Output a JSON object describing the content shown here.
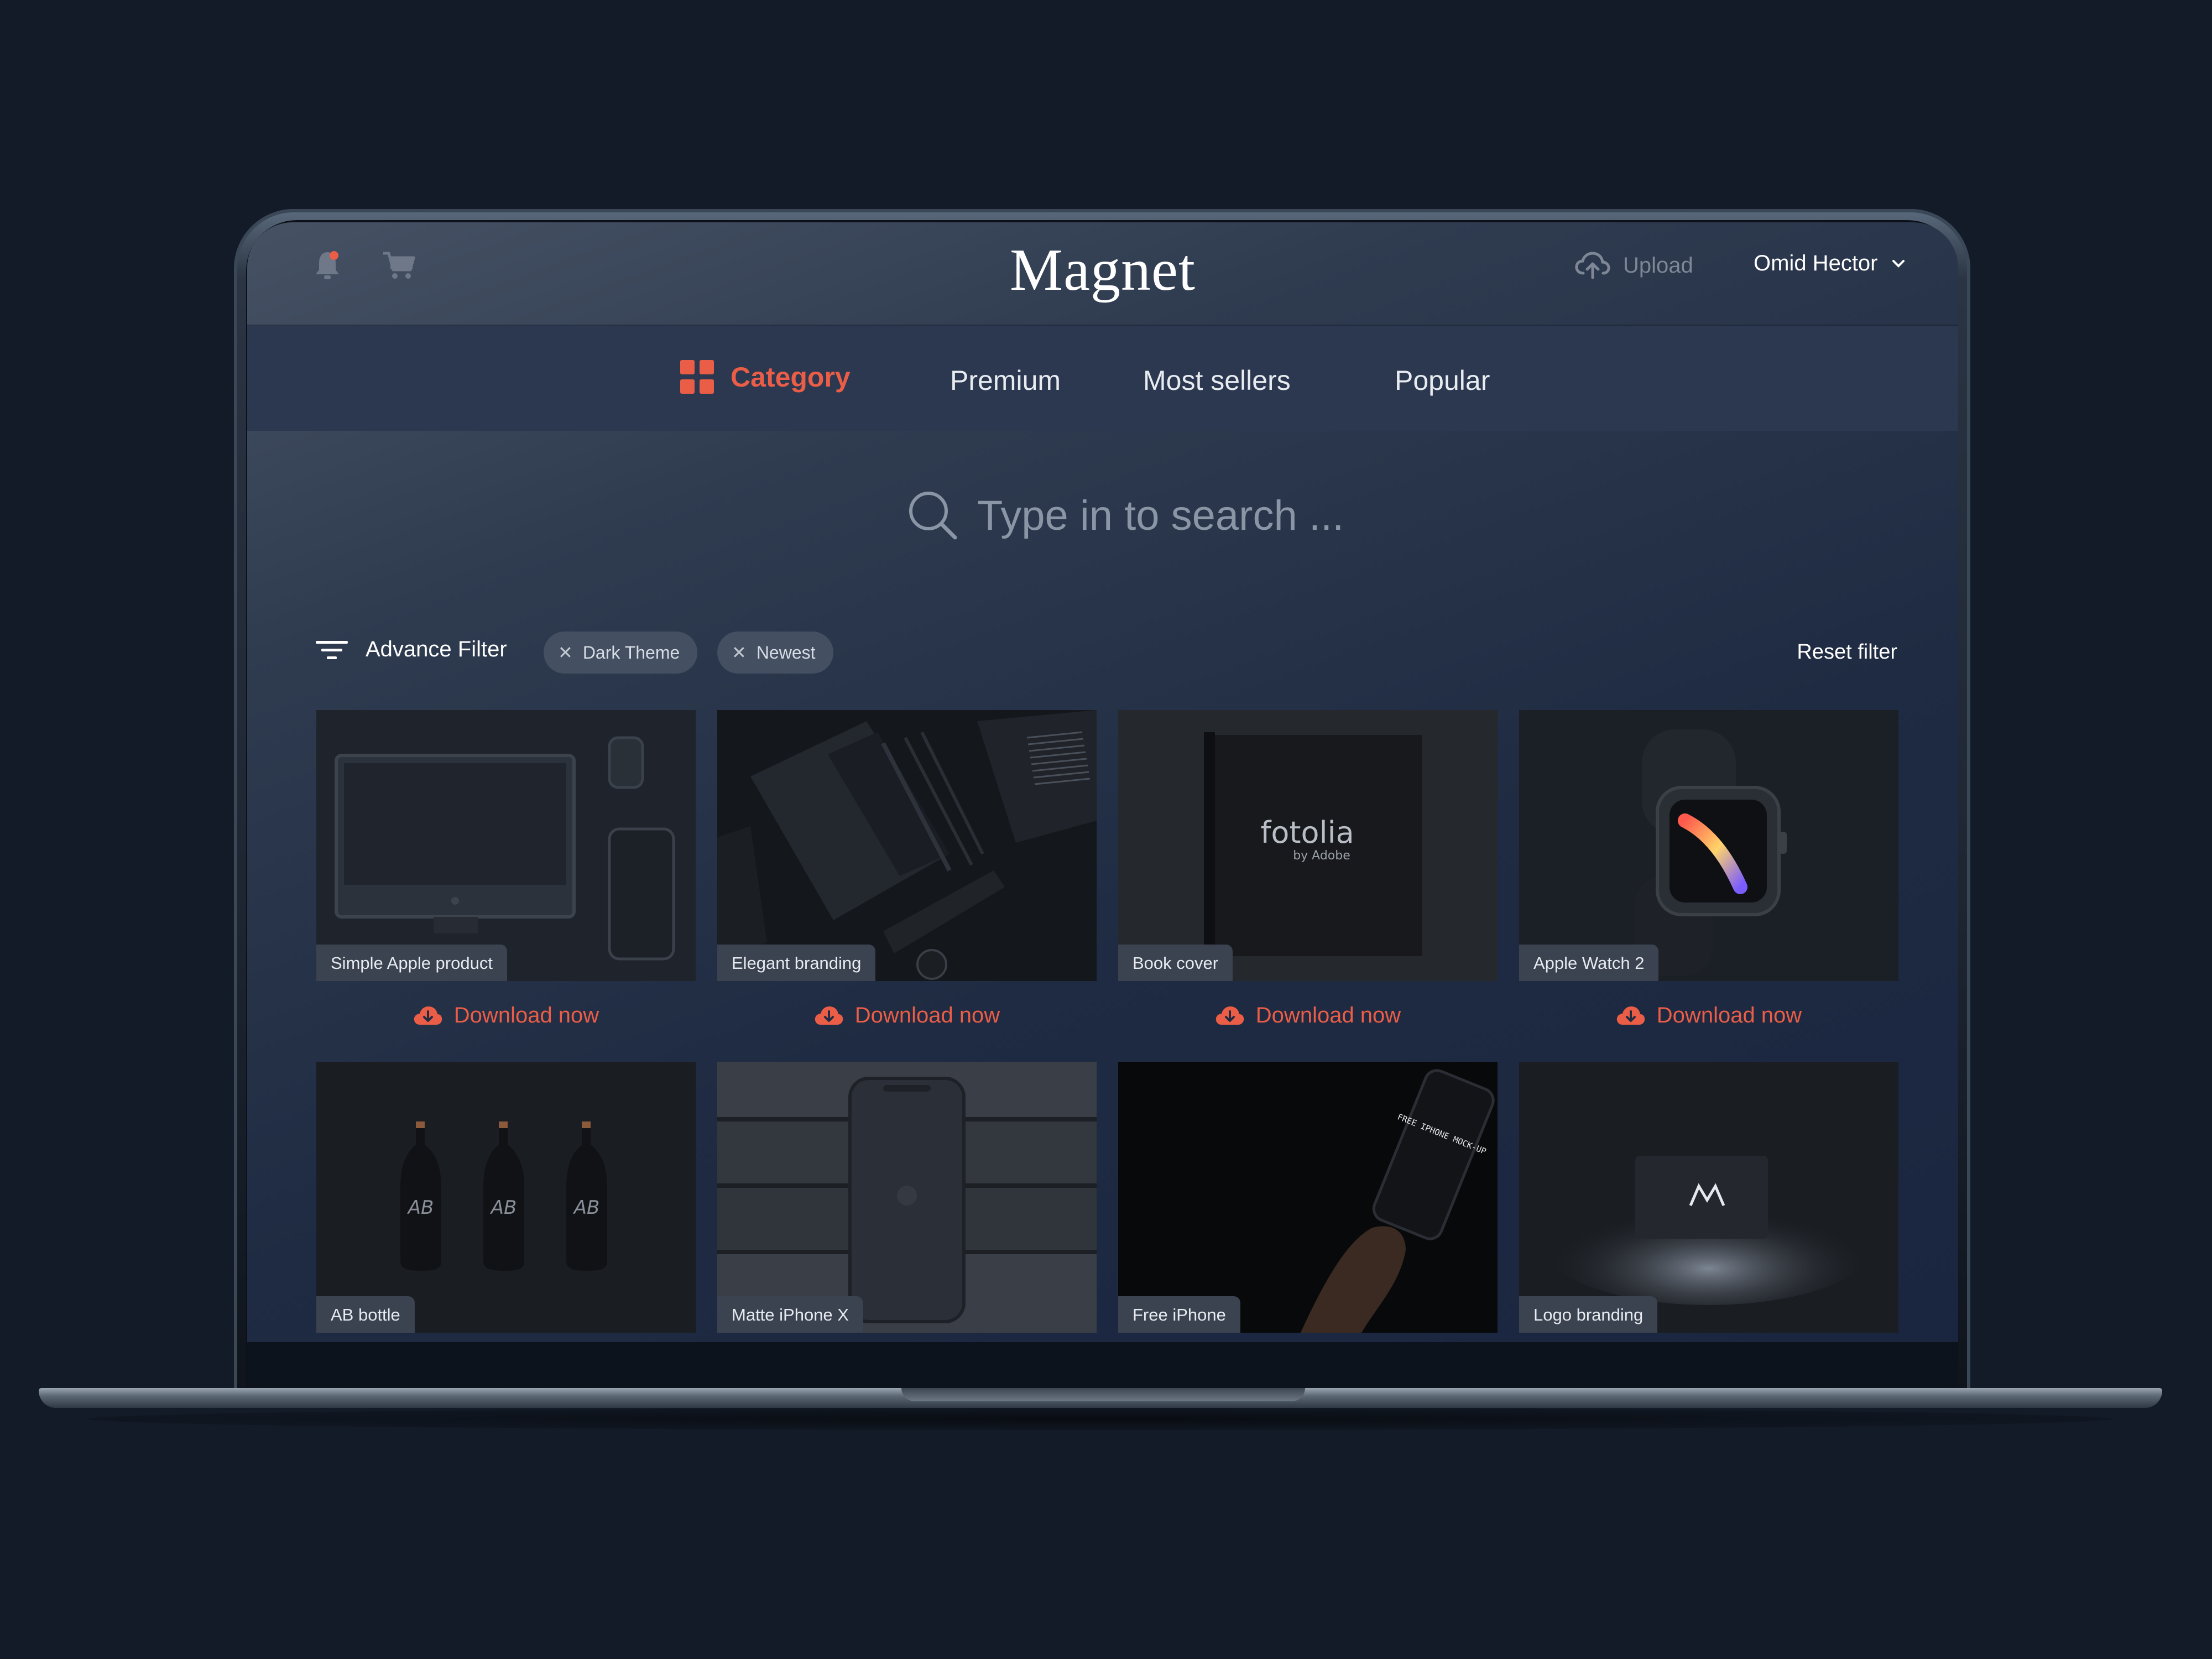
{
  "app": {
    "title": "Magnet"
  },
  "header": {
    "upload_label": "Upload",
    "user_name": "Omid Hector"
  },
  "nav": {
    "items": [
      {
        "label": "Category",
        "active": true
      },
      {
        "label": "Premium"
      },
      {
        "label": "Most sellers"
      },
      {
        "label": "Popular"
      }
    ]
  },
  "search": {
    "placeholder": "Type in to search ..."
  },
  "filters": {
    "advance_label": "Advance Filter",
    "chips": [
      "Dark Theme",
      "Newest"
    ],
    "reset_label": "Reset filter"
  },
  "products": [
    {
      "label": "Simple Apple product",
      "download": "Download now"
    },
    {
      "label": "Elegant branding",
      "download": "Download now"
    },
    {
      "label": "Book cover",
      "download": "Download now"
    },
    {
      "label": "Apple Watch 2",
      "download": "Download now"
    },
    {
      "label": "AB bottle"
    },
    {
      "label": "Matte iPhone X"
    },
    {
      "label": "Free iPhone"
    },
    {
      "label": "Logo branding"
    }
  ],
  "thumb_text": {
    "fotolia": "fotolia",
    "by_adobe": "by Adobe",
    "ab": "AB",
    "free_iphone": "FREE IPHONE MOCK-UP"
  },
  "colors": {
    "accent": "#ea5d46",
    "background": "#131b28",
    "nav_bg": "#2b3850"
  }
}
